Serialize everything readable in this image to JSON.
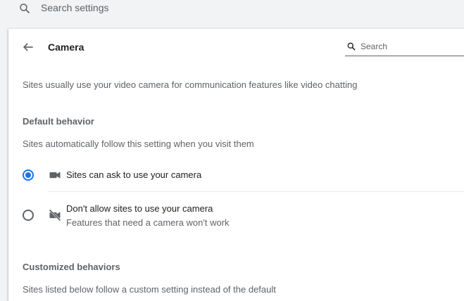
{
  "top_search": {
    "placeholder": "Search settings",
    "icon": "search-icon"
  },
  "header": {
    "title": "Camera",
    "back_icon": "back-arrow-icon",
    "search_placeholder": "Search",
    "search_icon": "search-icon"
  },
  "description": "Sites usually use your video camera for communication features like video chatting",
  "default_behavior": {
    "title": "Default behavior",
    "subtitle": "Sites automatically follow this setting when you visit them",
    "options": [
      {
        "label": "Sites can ask to use your camera",
        "sublabel": "",
        "icon": "camera-icon",
        "selected": true
      },
      {
        "label": "Don't allow sites to use your camera",
        "sublabel": "Features that need a camera won't work",
        "icon": "camera-off-icon",
        "selected": false
      }
    ]
  },
  "customized_behaviors": {
    "title": "Customized behaviors",
    "subtitle": "Sites listed below follow a custom setting instead of the default"
  },
  "colors": {
    "accent": "#1a73e8",
    "text_primary": "#202124",
    "text_secondary": "#5f6368",
    "background": "#f1f3f4",
    "card": "#ffffff"
  }
}
